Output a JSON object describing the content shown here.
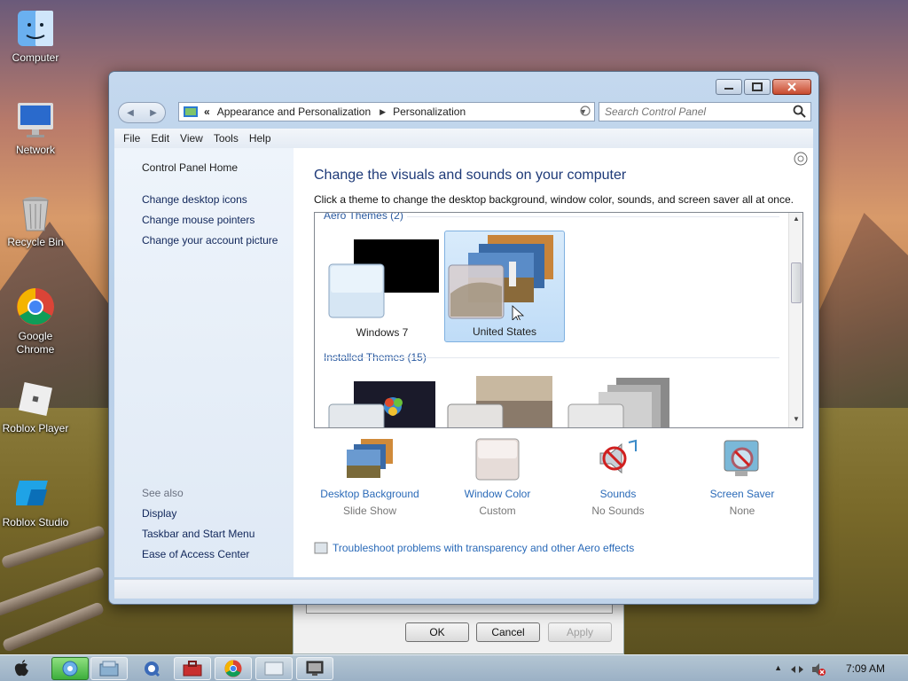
{
  "desktop": {
    "icons": [
      {
        "label": "Computer",
        "icon": "finder-icon"
      },
      {
        "label": "Network",
        "icon": "imac-icon"
      },
      {
        "label": "Recycle Bin",
        "icon": "trash-icon"
      },
      {
        "label": "Google Chrome",
        "icon": "chrome-icon"
      },
      {
        "label": "Roblox Player",
        "icon": "roblox-icon"
      },
      {
        "label": "Roblox Studio",
        "icon": "roblox-studio-icon"
      }
    ]
  },
  "window": {
    "address": {
      "prefix": "«",
      "crumbs": [
        "Appearance and Personalization",
        "Personalization"
      ]
    },
    "search_placeholder": "Search Control Panel",
    "menu": [
      "File",
      "Edit",
      "View",
      "Tools",
      "Help"
    ],
    "left_pane": {
      "home": "Control Panel Home",
      "links": [
        "Change desktop icons",
        "Change mouse pointers",
        "Change your account picture"
      ],
      "see_also_label": "See also",
      "see_also": [
        "Display",
        "Taskbar and Start Menu",
        "Ease of Access Center"
      ]
    },
    "main": {
      "title": "Change the visuals and sounds on your computer",
      "subtitle": "Click a theme to change the desktop background, window color, sounds, and screen saver all at once.",
      "aero_header": "Aero Themes (2)",
      "installed_header": "Installed Themes (15)",
      "aero_themes": [
        {
          "name": "Windows 7",
          "selected": false
        },
        {
          "name": "United States",
          "selected": true
        }
      ]
    },
    "bottom_items": [
      {
        "label": "Desktop Background",
        "value": "Slide Show",
        "icon": "landscape-icon"
      },
      {
        "label": "Window Color",
        "value": "Custom",
        "icon": "color-swatch-icon"
      },
      {
        "label": "Sounds",
        "value": "No Sounds",
        "icon": "sounds-icon"
      },
      {
        "label": "Screen Saver",
        "value": "None",
        "icon": "screen-saver-icon"
      }
    ],
    "troubleshoot": "Troubleshoot problems with transparency and other Aero effects"
  },
  "dialog": {
    "ok": "OK",
    "cancel": "Cancel",
    "apply": "Apply"
  },
  "taskbar": {
    "clock": "7:09 AM"
  },
  "colors": {
    "link": "#2a6ab8",
    "title": "#1e3a78",
    "selection": "#bfdcf7"
  }
}
